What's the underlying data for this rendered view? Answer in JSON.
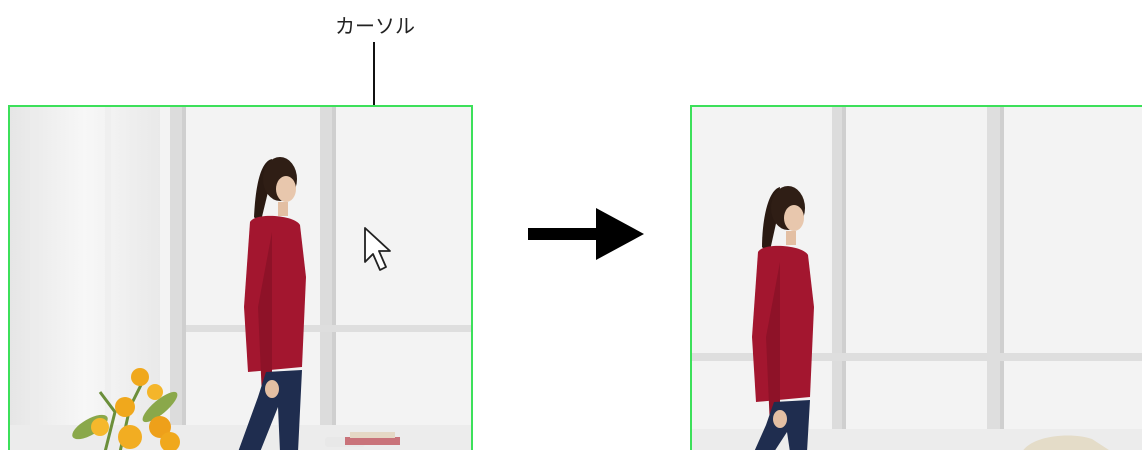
{
  "callout": {
    "label": "カーソル"
  },
  "icons": {
    "cursor": "mouse-pointer-arrow",
    "transition_arrow": "right-arrow"
  },
  "colors": {
    "frame_border": "#3ce05a",
    "sweater": "#a3162f",
    "jeans": "#1f2d4f",
    "hair": "#2a1a12",
    "flowers": "#f0a81c"
  }
}
